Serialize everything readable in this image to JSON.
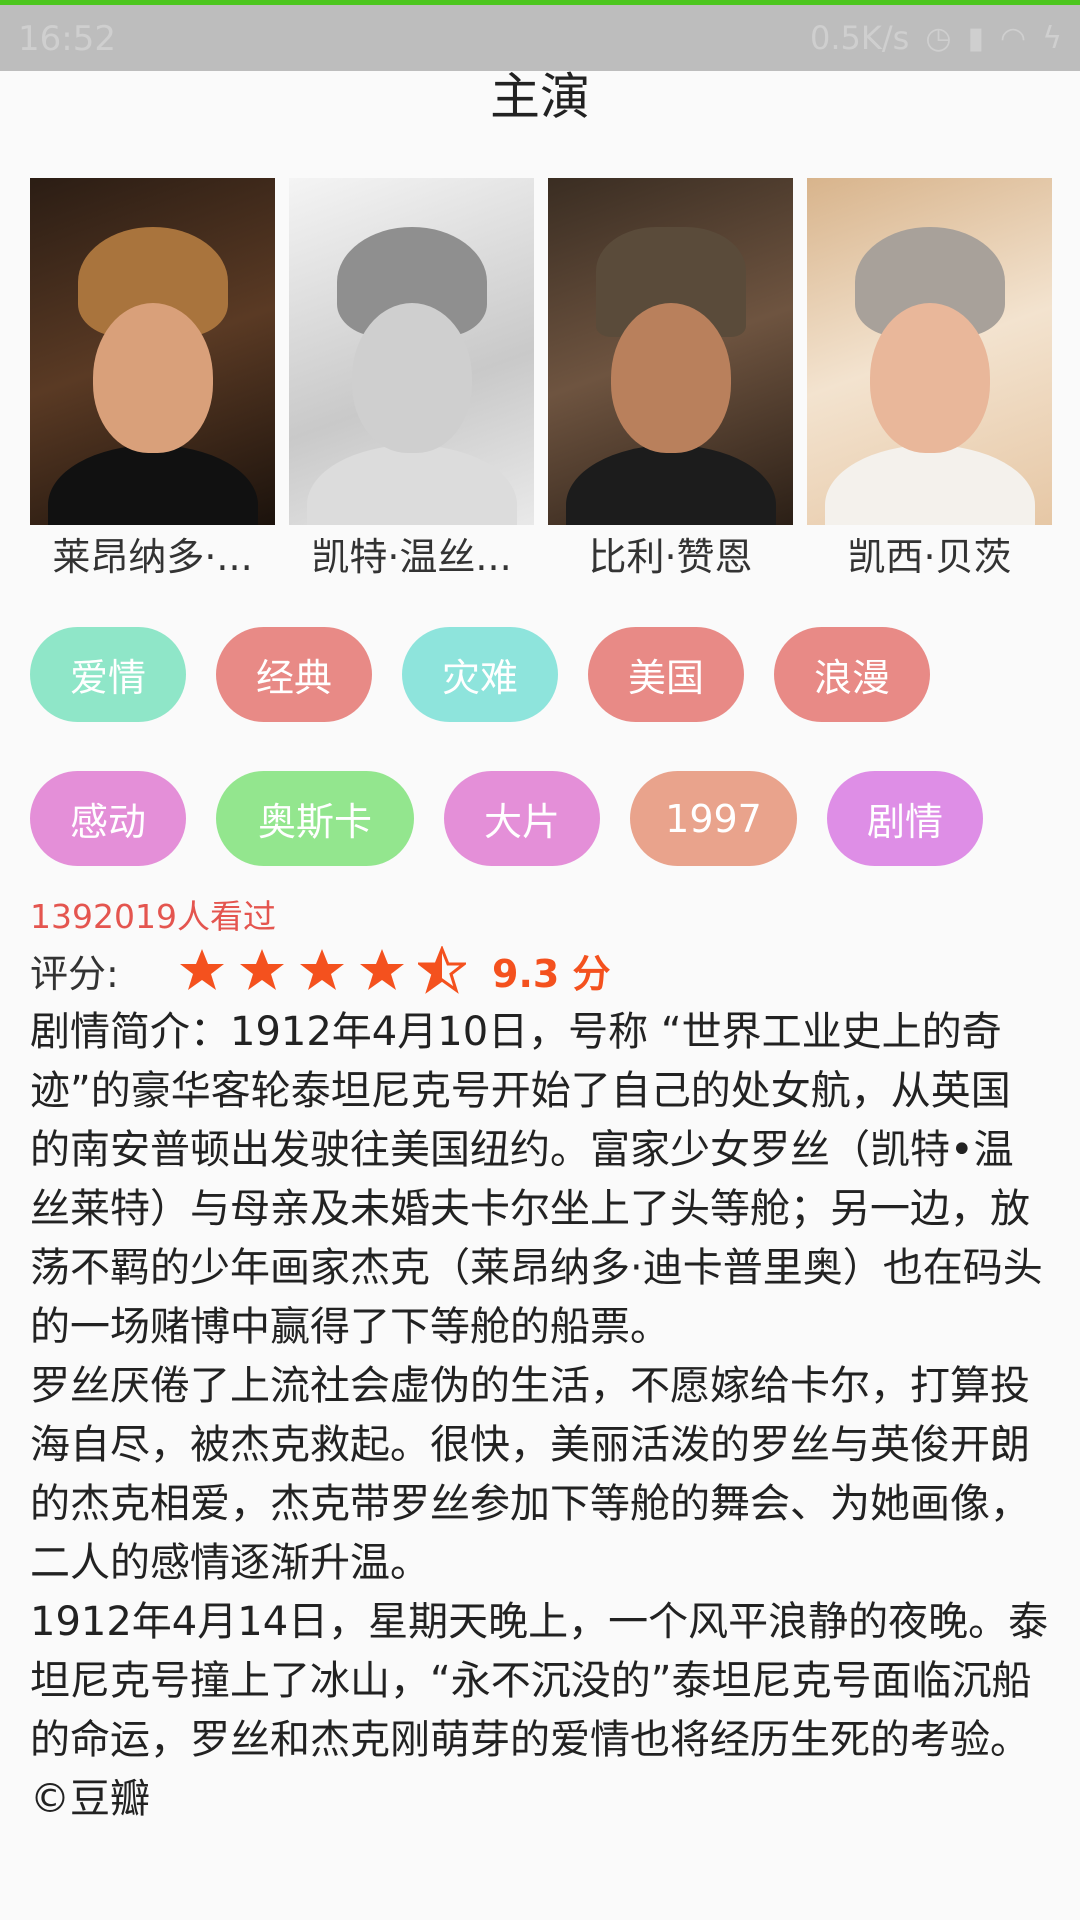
{
  "status_bar": {
    "time": "16:52",
    "net_speed": "0.5K/s"
  },
  "section_title": "主演",
  "cast": [
    {
      "name": "莱昂纳多·..."
    },
    {
      "name": "凯特·温丝..."
    },
    {
      "name": "比利·赞恩"
    },
    {
      "name": "凯西·贝茨"
    }
  ],
  "tags_row1": [
    {
      "label": "爱情",
      "color": "#8fe6c8"
    },
    {
      "label": "经典",
      "color": "#e88a86"
    },
    {
      "label": "灾难",
      "color": "#8ee4dc"
    },
    {
      "label": "美国",
      "color": "#e88a86"
    },
    {
      "label": "浪漫",
      "color": "#e88a86"
    }
  ],
  "tags_row2": [
    {
      "label": "感动",
      "color": "#e48fd8"
    },
    {
      "label": "奥斯卡",
      "color": "#93e68e"
    },
    {
      "label": "大片",
      "color": "#e48fd8"
    },
    {
      "label": "1997",
      "color": "#e9a38c"
    },
    {
      "label": "剧情",
      "color": "#de8ee6"
    }
  ],
  "viewed": "1392019人看过",
  "rating": {
    "label": "评分:",
    "stars": 4.5,
    "star_color": "#f4511e",
    "score": "9.3 分"
  },
  "summary": "剧情简介：1912年4月10日，号称 “世界工业史上的奇迹”的豪华客轮泰坦尼克号开始了自己的处女航，从英国的南安普顿出发驶往美国纽约。富家少女罗丝（凯特•温丝莱特）与母亲及未婚夫卡尔坐上了头等舱；另一边，放荡不羁的少年画家杰克（莱昂纳多·迪卡普里奥）也在码头的一场赌博中赢得了下等舱的船票。\n罗丝厌倦了上流社会虚伪的生活，不愿嫁给卡尔，打算投海自尽，被杰克救起。很快，美丽活泼的罗丝与英俊开朗的杰克相爱，杰克带罗丝参加下等舱的舞会、为她画像，二人的感情逐渐升温。\n1912年4月14日，星期天晚上，一个风平浪静的夜晚。泰坦尼克号撞上了冰山，“永不沉没的”泰坦尼克号面临沉船的命运，罗丝和杰克刚萌芽的爱情也将经历生死的考验。©豆瓣"
}
